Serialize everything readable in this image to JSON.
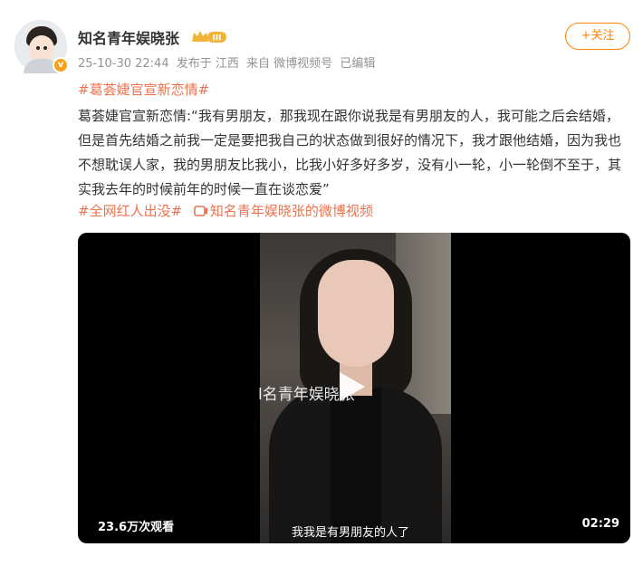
{
  "author": {
    "name": "知名青年娱晓张",
    "level_badge": "III",
    "verified_mark": "v"
  },
  "meta": {
    "time": "25-10-30 22:44",
    "location": "发布于 江西",
    "source": "来自 微博视频号",
    "edited": "已编辑"
  },
  "follow_button": "+关注",
  "topic": "#葛荟婕官宣新恋情#",
  "text": "葛荟婕官宣新恋情:“我有男朋友，那我现在跟你说我是有男朋友的人，我可能之后会结婚，但是首先结婚之前我一定是要把我自己的状态做到很好的情况下，我才跟他结婚，因为我也不想耽误人家，我的男朋友比我小，比我小好多好多岁，没有小一轮，小一轮倒不至于，其实我去年的时候前年的时候一直在谈恋爱”",
  "tags": {
    "hashtag": "#全网红人出没#",
    "video_link": "知名青年娱晓张的微博视频"
  },
  "video": {
    "watermark": "l名青年娱晓张",
    "views": "23.6万次观看",
    "subtitle": "我我是有男朋友的人了",
    "duration": "02:29"
  },
  "colors": {
    "accent": "#ff8200",
    "link": "#eb7350",
    "meta": "#939393",
    "text": "#333333"
  },
  "icons": [
    "crown-icon",
    "verified-icon",
    "video-link-icon",
    "play-icon"
  ]
}
